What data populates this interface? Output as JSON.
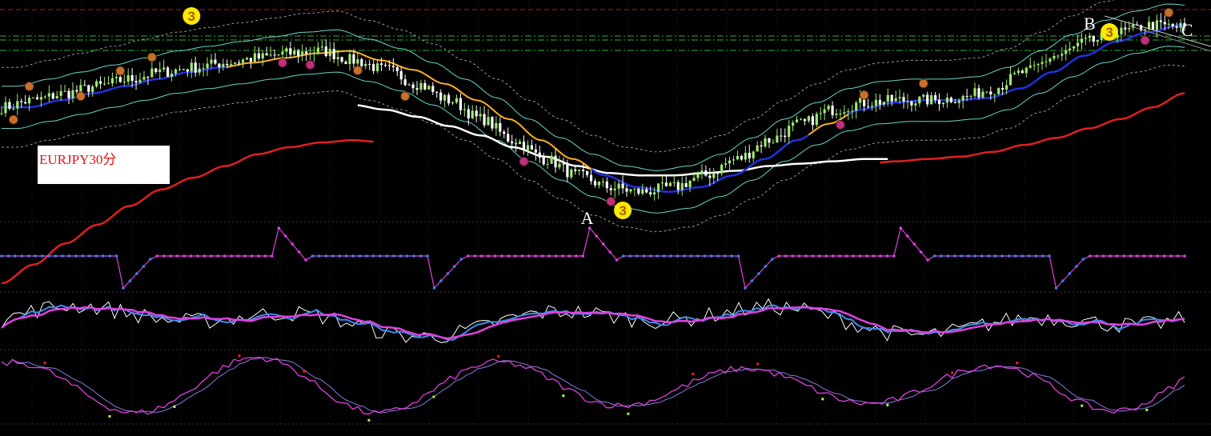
{
  "symbol_label": "EURJPY30分",
  "colors": {
    "background": "#000000",
    "bull": "#9fe870",
    "bear": "#ffffff",
    "ma_white": "#ffffff",
    "ma_red": "#e02020",
    "ma_blue": "#2230e0",
    "ma_orange": "#ffb020",
    "band_cyan": "#67d6c9",
    "band_dash": "#9a9a9a",
    "level_green": "#30b030",
    "level_red": "#c01a1a",
    "marker_up": "#c8702a",
    "marker_down": "#c0307a",
    "badge_yellow": "#ffe800",
    "zz_up": "#3b82f6",
    "zz_down": "#e040e0",
    "stoch_main": "#ffffff",
    "stoch_fast": "#3b8fe8",
    "stoch_slow": "#e040e0",
    "grid": "#222222"
  },
  "point_labels": [
    {
      "text": "A",
      "x_index": 148
    },
    {
      "text": "B",
      "x_index": 275
    },
    {
      "text": "C",
      "x_index": 298
    }
  ],
  "badges": [
    {
      "text": "3",
      "x_index": 48,
      "where": "top"
    },
    {
      "text": "3",
      "x_index": 157,
      "where": "low"
    },
    {
      "text": "3",
      "x_index": 280,
      "where": "high"
    }
  ],
  "chart_data": {
    "type": "line",
    "title": "EURJPY30分",
    "panels": [
      {
        "name": "price",
        "series": [
          {
            "role": "close",
            "values": [
              124.0,
              124.3,
              124.6,
              124.9,
              125.2,
              125.5,
              125.7,
              125.9,
              126.1,
              126.3,
              126.4,
              126.0,
              125.6,
              125.0,
              124.3,
              123.5,
              122.6,
              121.8,
              121.1,
              120.6,
              120.4,
              120.6,
              121.1,
              121.8,
              122.6,
              123.3,
              123.9,
              124.2,
              124.3,
              124.3,
              124.4,
              124.8,
              125.5,
              126.2,
              126.8,
              127.2,
              127.5,
              127.4
            ]
          },
          {
            "name": "",
            "role": "ma-red",
            "values": [
              116.5,
              117.3,
              118.2,
              119.0,
              119.8,
              120.5,
              121.0,
              121.5,
              122.0,
              122.3,
              122.5,
              122.6,
              122.5,
              122.4,
              122.3,
              122.2,
              122.1,
              122.0,
              121.9,
              121.8,
              121.7,
              121.6,
              121.5,
              121.5,
              121.4,
              121.5,
              121.5,
              121.6,
              121.7,
              121.8,
              121.9,
              122.1,
              122.4,
              122.7,
              123.1,
              123.5,
              124.0,
              124.6
            ]
          },
          {
            "name": "",
            "role": "ma-white",
            "values": [
              123.5,
              123.6,
              123.7,
              123.8,
              123.9,
              124.0,
              124.1,
              124.2,
              124.3,
              124.3,
              124.2,
              124.1,
              123.9,
              123.6,
              123.2,
              122.8,
              122.3,
              121.9,
              121.5,
              121.2,
              121.1,
              121.1,
              121.2,
              121.3,
              121.5,
              121.6,
              121.7,
              121.8,
              121.8,
              121.9,
              122.0,
              122.2,
              122.5,
              122.9,
              123.4,
              123.9,
              124.4,
              124.8
            ]
          }
        ]
      },
      {
        "name": "zigzag",
        "type": "line",
        "ylim": [
          -100,
          100
        ]
      },
      {
        "name": "stochastic",
        "type": "line",
        "ylim": [
          0,
          100
        ]
      },
      {
        "name": "rsi",
        "type": "line",
        "ylim": [
          0,
          100
        ]
      }
    ]
  }
}
